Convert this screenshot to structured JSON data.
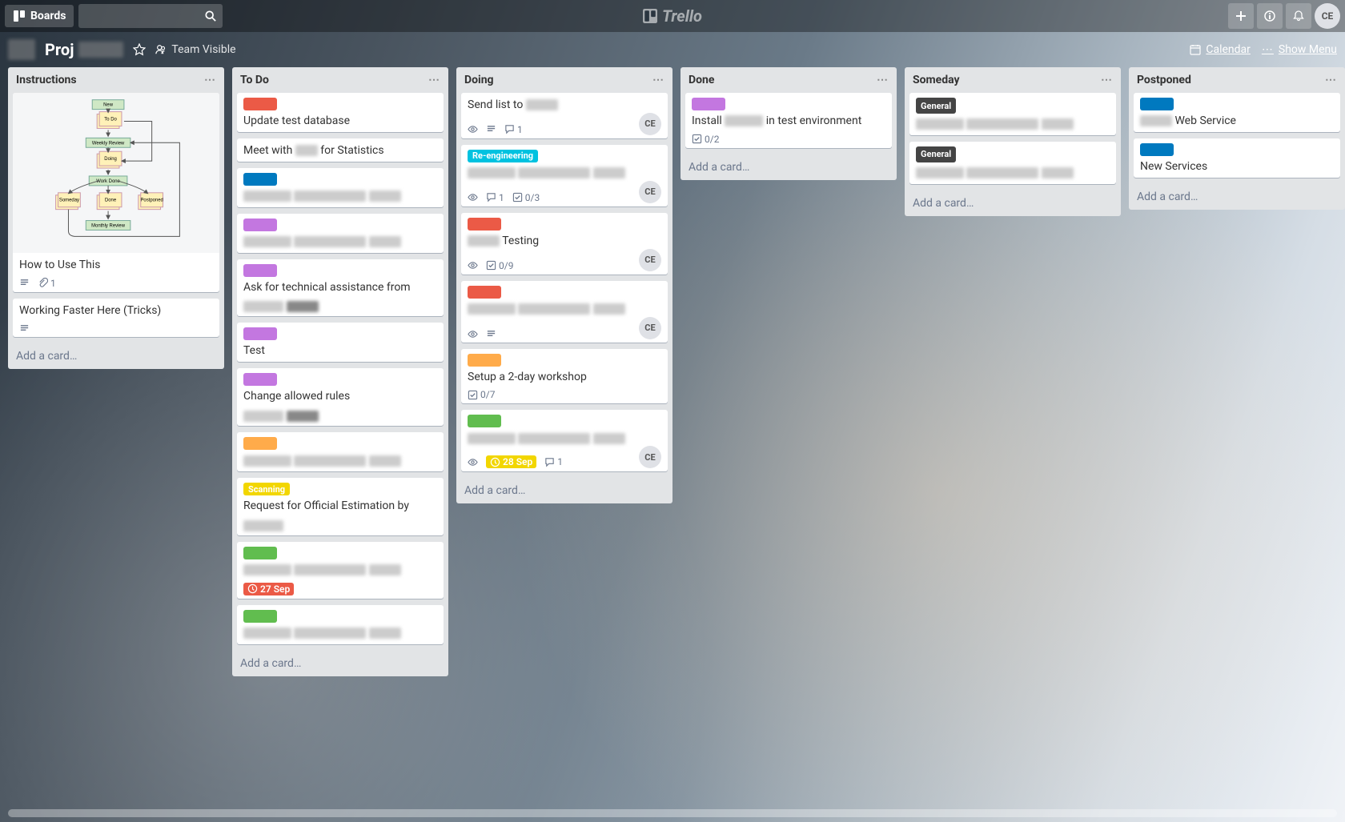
{
  "header": {
    "boards_label": "Boards",
    "brand": "Trello",
    "avatar_initials": "CE"
  },
  "board_header": {
    "title": "Proj",
    "visibility": "Team Visible",
    "calendar": "Calendar",
    "show_menu": "Show Menu"
  },
  "add_card_label": "Add a card…",
  "member_initials": "CE",
  "colors": {
    "red": "#eb5a46",
    "orange": "#ffab4a",
    "yellow": "#f2d600",
    "green": "#61bd4f",
    "teal": "#00c2e0",
    "blue": "#0079bf",
    "purple": "#c377e0"
  },
  "lists": [
    {
      "name": "Instructions",
      "cards": [
        {
          "title": "How to Use This",
          "cover": "flowchart",
          "badges": {
            "description": true,
            "attachments": "1"
          }
        },
        {
          "title": "Working Faster Here (Tricks)",
          "badges": {
            "description": true
          }
        }
      ]
    },
    {
      "name": "To Do",
      "cards": [
        {
          "labels": [
            {
              "color": "red"
            }
          ],
          "title": "Update test database"
        },
        {
          "title_prefix": "Meet with ",
          "title_blur": 28,
          "title_suffix": " for Statistics"
        },
        {
          "labels": [
            {
              "color": "blue"
            }
          ],
          "blurred_body": true
        },
        {
          "labels": [
            {
              "color": "purple"
            }
          ],
          "blurred_body": true
        },
        {
          "labels": [
            {
              "color": "purple"
            }
          ],
          "title": "Ask for technical assistance from",
          "blurred_tail": true
        },
        {
          "labels": [
            {
              "color": "purple"
            }
          ],
          "title": "Test"
        },
        {
          "labels": [
            {
              "color": "purple"
            }
          ],
          "title": "Change allowed rules",
          "blurred_tail": true
        },
        {
          "labels": [
            {
              "color": "orange"
            }
          ],
          "blurred_body": true
        },
        {
          "labels": [
            {
              "color": "yellow",
              "text": "Scanning"
            }
          ],
          "title": "Request for Official Estimation by",
          "blurred_tail_short": true
        },
        {
          "labels": [
            {
              "color": "green"
            }
          ],
          "blurred_body": true,
          "badges": {
            "due": "27 Sep",
            "due_color": "red"
          }
        },
        {
          "labels": [
            {
              "color": "green"
            }
          ],
          "blurred_body": true
        }
      ]
    },
    {
      "name": "Doing",
      "cards": [
        {
          "title_prefix": "Send list to ",
          "title_blur": 40,
          "badges": {
            "watch": true,
            "description": true,
            "comments": "1"
          },
          "member": true
        },
        {
          "labels": [
            {
              "color": "teal",
              "text": "Re-engineering"
            }
          ],
          "blurred_body": true,
          "badges": {
            "watch": true,
            "comments": "1",
            "checklist": "0/3"
          },
          "member": true
        },
        {
          "labels": [
            {
              "color": "red"
            }
          ],
          "title_prefix": "",
          "title_blur": 40,
          "title_suffix": " Testing",
          "badges": {
            "watch": true,
            "checklist": "0/9"
          },
          "member": true
        },
        {
          "labels": [
            {
              "color": "red"
            }
          ],
          "blurred_body": true,
          "badges": {
            "watch": true,
            "description": true
          },
          "member": true
        },
        {
          "labels": [
            {
              "color": "orange"
            }
          ],
          "title": "Setup a 2-day workshop",
          "badges": {
            "checklist": "0/7"
          }
        },
        {
          "labels": [
            {
              "color": "green"
            }
          ],
          "blurred_body": true,
          "badges": {
            "watch": true,
            "due": "28 Sep",
            "due_color": "yellow",
            "comments": "1"
          },
          "member": true
        }
      ]
    },
    {
      "name": "Done",
      "cards": [
        {
          "labels": [
            {
              "color": "purple"
            }
          ],
          "title_prefix": "Install ",
          "title_blur": 48,
          "title_suffix": " in test environment",
          "badges": {
            "checklist": "0/2"
          }
        }
      ]
    },
    {
      "name": "Someday",
      "cards": [
        {
          "labels": [
            {
              "color": "dark",
              "text": "General"
            }
          ],
          "blurred_body": true
        },
        {
          "labels": [
            {
              "color": "dark",
              "text": "General"
            }
          ],
          "blurred_body": true
        }
      ]
    },
    {
      "name": "Postponed",
      "cards": [
        {
          "labels": [
            {
              "color": "blue"
            }
          ],
          "title_prefix": "",
          "title_blur": 40,
          "title_suffix": " Web Service"
        },
        {
          "labels": [
            {
              "color": "blue"
            }
          ],
          "title": "New Services"
        }
      ]
    }
  ],
  "flowchart": {
    "nodes": [
      "New",
      "To Do",
      "Weekly Review",
      "Doing",
      "Work Done",
      "Someday",
      "Done",
      "Postponed",
      "Monthly Review"
    ]
  }
}
